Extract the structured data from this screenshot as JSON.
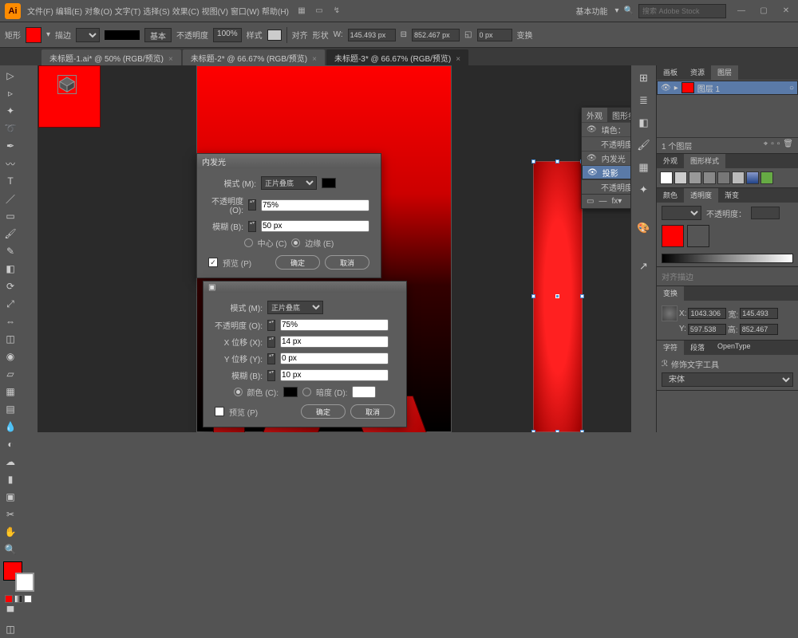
{
  "app": {
    "logo": "Ai"
  },
  "menus": [
    "文件(F)",
    "编辑(E)",
    "对象(O)",
    "文字(T)",
    "选择(S)",
    "效果(C)",
    "视图(V)",
    "窗口(W)",
    "帮助(H)"
  ],
  "topright": {
    "label_basics": "基本功能",
    "search_placeholder": "搜索 Adobe Stock"
  },
  "optionsbar": {
    "tool_label": "矩形",
    "stroke_label": "描边",
    "basic": "基本",
    "opacity_label": "不透明度",
    "opacity": "100%",
    "style_label": "样式",
    "align": "对齐",
    "transform": "形状",
    "w_prefix": "W:",
    "w": "145.493 px",
    "h_prefix": "H:",
    "h": "852.467 px",
    "corner": "0 px",
    "more": "变换"
  },
  "tabs": [
    {
      "title": "未标题-1.ai* @ 50% (RGB/预览)",
      "active": false
    },
    {
      "title": "未标题-2* @ 66.67% (RGB/预览)",
      "active": false
    },
    {
      "title": "未标题-3* @ 66.67% (RGB/预览)",
      "active": true
    }
  ],
  "appearance": {
    "tab1": "外观",
    "tab2": "图形参考",
    "fill_label": "填色：",
    "opacity_row": "不透明度：默认值",
    "rows": [
      "内发光",
      "投影",
      "不透明度：默认值"
    ],
    "sel_index": 1
  },
  "dlg1": {
    "title": "内发光",
    "mode_label": "模式 (M):",
    "mode_val": "正片叠底",
    "opacity_label": "不透明度 (O):",
    "opacity_val": "75%",
    "blur_label": "模糊 (B):",
    "blur_val": "50 px",
    "center": "中心 (C)",
    "edge": "边缘 (E)",
    "preview": "预览 (P)",
    "ok": "确定",
    "cancel": "取消"
  },
  "dlg2": {
    "mode_label": "模式 (M):",
    "mode_val": "正片叠底",
    "opacity_label": "不透明度 (O):",
    "opacity_val": "75%",
    "xoff_label": "X 位移 (X):",
    "xoff_val": "14 px",
    "yoff_label": "Y 位移 (Y):",
    "yoff_val": "0 px",
    "blur_label": "模糊 (B):",
    "blur_val": "10 px",
    "color": "颜色 (C):",
    "dark": "暗度 (D):",
    "dark_val": "",
    "preview": "预览 (P)",
    "ok": "确定",
    "cancel": "取消"
  },
  "layers": {
    "tabs": [
      "画板",
      "资源",
      "图层"
    ],
    "row": "图层 1",
    "count": "1 个图层"
  },
  "graphicstyles": {
    "tabs": [
      "外观",
      "图形样式"
    ]
  },
  "color": {
    "tabs": [
      "颜色",
      "透明度",
      "渐变"
    ],
    "opacity_label": "不透明度："
  },
  "stroke": {
    "item": "对齐描边"
  },
  "transform": {
    "tab": "变换",
    "x_label": "X:",
    "x": "1043.306",
    "w_label": "宽:",
    "w": "145.493",
    "y_label": "Y:",
    "y": "597.538",
    "h_label": "高:",
    "h": "852.467"
  },
  "chars": {
    "tabs": [
      "字符",
      "段落",
      "OpenType"
    ],
    "item": "修饰文字工具",
    "font": "宋体"
  }
}
